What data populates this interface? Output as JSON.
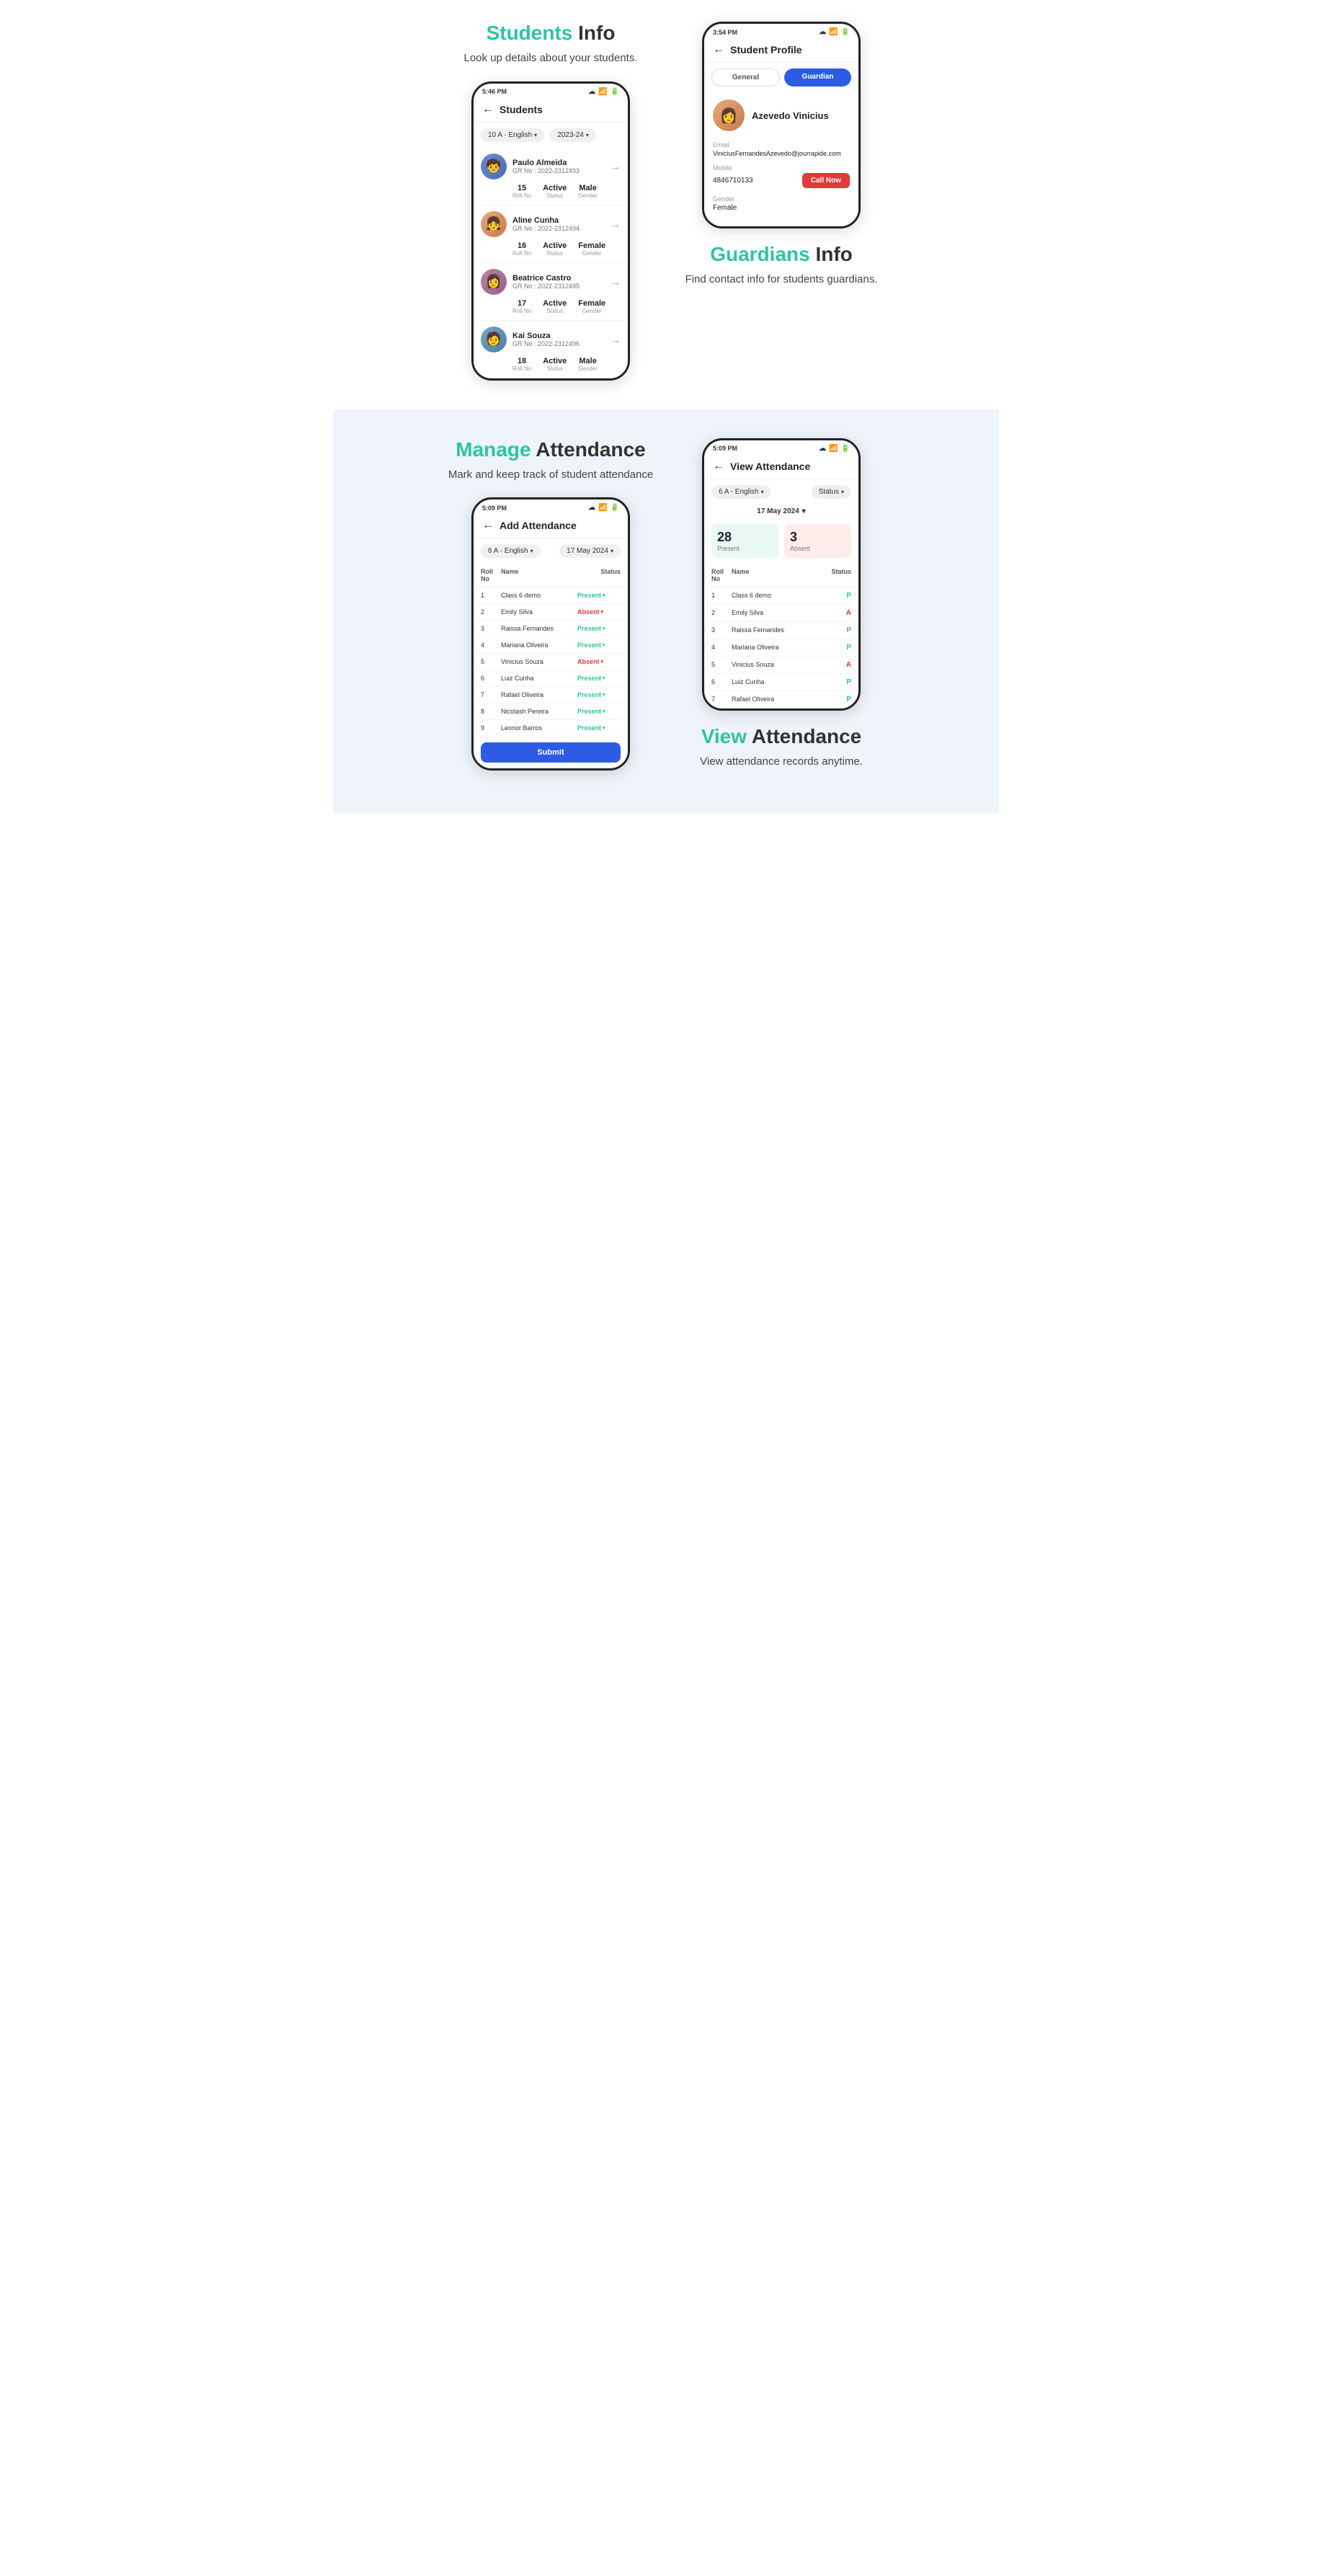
{
  "section1": {
    "left": {
      "title_highlight": "Students",
      "title_rest": " Info",
      "subtitle": "Look up details about your students.",
      "phone": {
        "time": "5:46 PM",
        "header": "Students",
        "filter_class": "10 A - English",
        "filter_year": "2023-24",
        "students": [
          {
            "name": "Paulo Almeida",
            "gr": "GR No : 2022-2312493",
            "roll": "15",
            "status": "Active",
            "gender": "Male",
            "avatar_type": "male1"
          },
          {
            "name": "Aline Cunha",
            "gr": "GR No : 2022-2312494",
            "roll": "16",
            "status": "Active",
            "gender": "Female",
            "avatar_type": "female1"
          },
          {
            "name": "Beatrice Castro",
            "gr": "GR No : 2022-2312495",
            "roll": "17",
            "status": "Active",
            "gender": "Female",
            "avatar_type": "female2"
          },
          {
            "name": "Kai Souza",
            "gr": "GR No : 2022-2312496",
            "roll": "18",
            "status": "Active",
            "gender": "Male",
            "avatar_type": "male2"
          }
        ]
      }
    },
    "right": {
      "phone": {
        "time": "3:54 PM",
        "header": "Student Profile",
        "tab_general": "General",
        "tab_guardian": "Guardian",
        "guardian_name": "Azevedo Vinicius",
        "email_label": "Email",
        "email_value": "ViniciusFernandesAzevedo@jourrapide.com",
        "mobile_label": "Mobile",
        "mobile_value": "4846710133",
        "gender_label": "Gender",
        "gender_value": "Female",
        "call_btn": "Call Now"
      },
      "title_highlight": "Guardians",
      "title_rest": " Info",
      "subtitle": "Find contact info for students guardians."
    }
  },
  "section2": {
    "left": {
      "title_highlight": "Manage",
      "title_rest": " Attendance",
      "subtitle": "Mark and keep track of  student attendance",
      "phone": {
        "time": "5:09 PM",
        "header": "Add Attendance",
        "filter_class": "6 A - English",
        "filter_date": "17 May 2024",
        "table_headers": [
          "Roll No",
          "Name",
          "Status"
        ],
        "rows": [
          {
            "roll": "1",
            "name": "Class 6 demo",
            "status": "Present",
            "status_type": "present"
          },
          {
            "roll": "2",
            "name": "Emily Silva",
            "status": "Absent",
            "status_type": "absent"
          },
          {
            "roll": "3",
            "name": "Raissa Fernandes",
            "status": "Present",
            "status_type": "present"
          },
          {
            "roll": "4",
            "name": "Mariana Oliveira",
            "status": "Present",
            "status_type": "present"
          },
          {
            "roll": "5",
            "name": "Vinicius Souza",
            "status": "Absent",
            "status_type": "absent"
          },
          {
            "roll": "6",
            "name": "Luiz Cunha",
            "status": "Present",
            "status_type": "present"
          },
          {
            "roll": "7",
            "name": "Rafael Oliveira",
            "status": "Present",
            "status_type": "present"
          },
          {
            "roll": "8",
            "name": "Nicolash Pereira",
            "status": "Present",
            "status_type": "present"
          },
          {
            "roll": "9",
            "name": "Leonor Barros",
            "status": "Present",
            "status_type": "present"
          }
        ],
        "submit_btn": "Submit"
      }
    },
    "right": {
      "phone": {
        "time": "5:09 PM",
        "header": "View Attendance",
        "filter_class": "6 A - English",
        "filter_status": "Status",
        "date": "17 May 2024",
        "present_count": "28",
        "present_label": "Present",
        "absent_count": "3",
        "absent_label": "Absent",
        "table_headers": [
          "Roll No",
          "Name",
          "Status"
        ],
        "rows": [
          {
            "roll": "1",
            "name": "Class 6 demo",
            "status": "P",
            "status_type": "present"
          },
          {
            "roll": "2",
            "name": "Emily Silva",
            "status": "A",
            "status_type": "absent"
          },
          {
            "roll": "3",
            "name": "Raissa Fernandes",
            "status": "P",
            "status_type": "present"
          },
          {
            "roll": "4",
            "name": "Mariana Oliveira",
            "status": "P",
            "status_type": "present"
          },
          {
            "roll": "5",
            "name": "Vinicius Souza",
            "status": "A",
            "status_type": "absent"
          },
          {
            "roll": "6",
            "name": "Luiz Cunha",
            "status": "P",
            "status_type": "present"
          },
          {
            "roll": "7",
            "name": "Rafael Oliveira",
            "status": "P",
            "status_type": "present"
          }
        ]
      },
      "title_highlight": "View",
      "title_rest": " Attendance",
      "subtitle": "View attendance records anytime."
    }
  }
}
